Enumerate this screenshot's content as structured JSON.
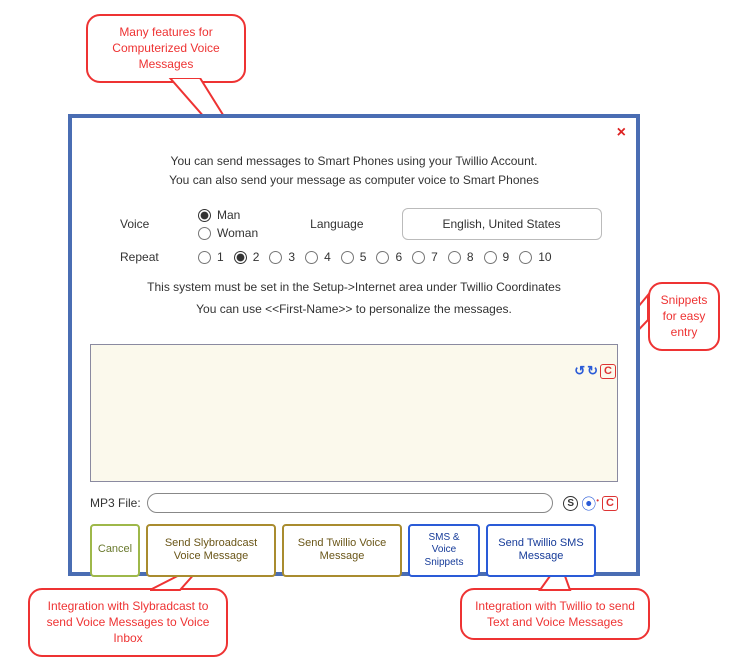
{
  "callouts": {
    "top": "Many features for Computerized Voice Messages",
    "right": "Snippets for easy entry",
    "bottomLeft": "Integration with Slybradcast to send Voice Messages to Voice Inbox",
    "bottomRight": "Integration with Twillio to send Text and Voice Messages"
  },
  "dialog": {
    "intro1": "You can send messages to Smart Phones using your Twillio Account.",
    "intro2": "You can also send your message as computer voice to Smart Phones",
    "voiceLabel": "Voice",
    "voiceOptions": {
      "man": "Man",
      "woman": "Woman"
    },
    "voiceSelected": "man",
    "languageLabel": "Language",
    "languageValue": "English, United States",
    "repeatLabel": "Repeat",
    "repeatOptions": [
      "1",
      "2",
      "3",
      "4",
      "5",
      "6",
      "7",
      "8",
      "9",
      "10"
    ],
    "repeatSelected": "2",
    "note1": "This system must be set in the Setup->Internet area under Twillio Coordinates",
    "note2": "You can use <<First-Name>> to personalize the messages.",
    "messageText": "",
    "mp3Label": "MP3 File:",
    "mp3Value": "",
    "icons": {
      "undo": "↺",
      "redo": "↻",
      "clear": "C",
      "s": "S",
      "target": "⦿",
      "dot": "•"
    },
    "buttons": {
      "cancel": "Cancel",
      "slybroadcast": "Send Slybroadcast Voice Message",
      "twillioVoice": "Send Twillio Voice Message",
      "snippets": "SMS & Voice Snippets",
      "twillioSms": "Send Twillio SMS Message"
    }
  }
}
